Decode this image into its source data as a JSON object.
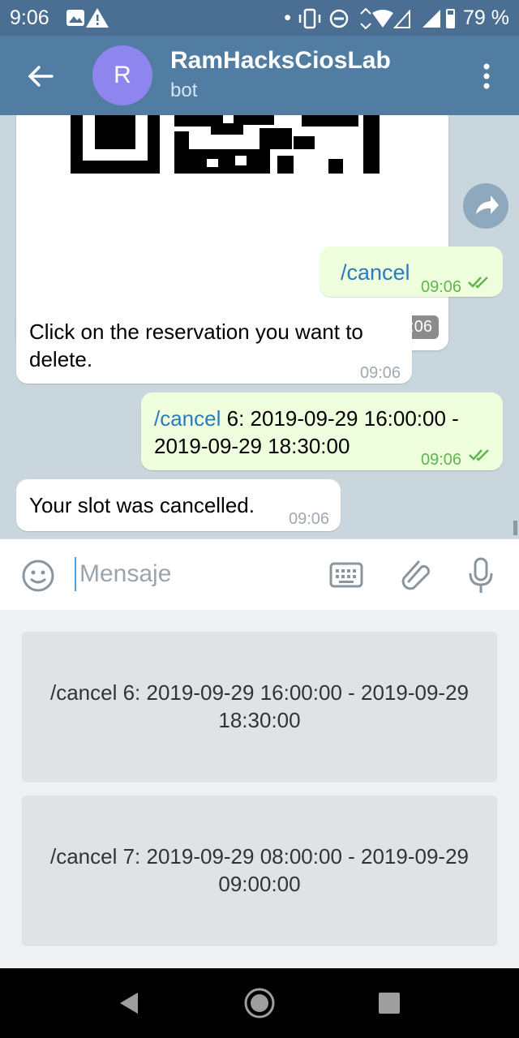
{
  "status": {
    "time": "9:06",
    "battery": "79 %"
  },
  "header": {
    "avatar_letter": "R",
    "title": "RamHacksCiosLab",
    "subtitle": "bot"
  },
  "messages": [
    {
      "type": "image",
      "time": "09:06"
    },
    {
      "type": "outgoing",
      "command": "/cancel",
      "text": "",
      "time": "09:06"
    },
    {
      "type": "incoming",
      "text": "Click on the reservation you want to delete.",
      "time": "09:06"
    },
    {
      "type": "outgoing",
      "command": "/cancel",
      "text": " 6: 2019-09-29 16:00:00 - 2019-09-29 18:30:00",
      "time": "09:06"
    },
    {
      "type": "incoming",
      "text": "Your slot was cancelled.",
      "time": "09:06"
    }
  ],
  "input": {
    "placeholder": "Mensaje"
  },
  "keyboard": {
    "buttons": [
      {
        "label": "/cancel 6: 2019-09-29 16:00:00 - 2019-09-29 18:30:00"
      },
      {
        "label": "/cancel 7: 2019-09-29 08:00:00 - 2019-09-29 09:00:00"
      }
    ]
  },
  "colors": {
    "header": "#517da2",
    "status": "#4a6f92",
    "avatar": "#8e85ee",
    "link": "#2a7ac0",
    "check": "#5cb64a"
  }
}
